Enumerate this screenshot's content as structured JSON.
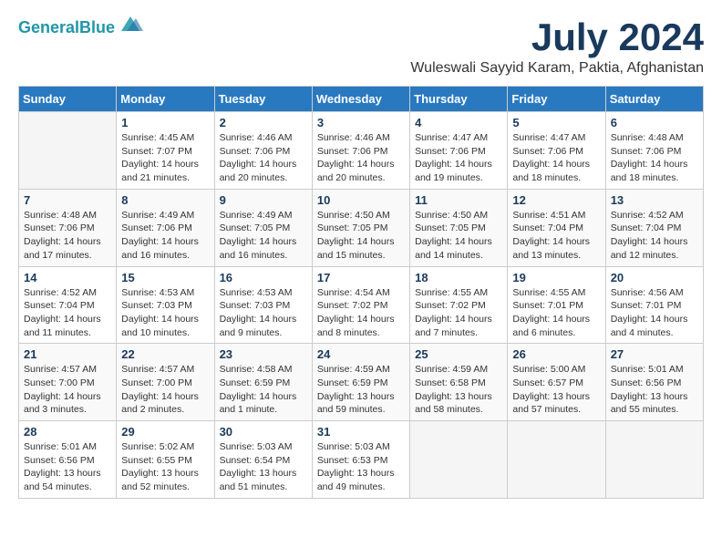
{
  "header": {
    "logo_line1": "General",
    "logo_line2": "Blue",
    "month": "July 2024",
    "location": "Wuleswali Sayyid Karam, Paktia, Afghanistan"
  },
  "weekdays": [
    "Sunday",
    "Monday",
    "Tuesday",
    "Wednesday",
    "Thursday",
    "Friday",
    "Saturday"
  ],
  "weeks": [
    [
      {
        "num": "",
        "info": ""
      },
      {
        "num": "1",
        "info": "Sunrise: 4:45 AM\nSunset: 7:07 PM\nDaylight: 14 hours\nand 21 minutes."
      },
      {
        "num": "2",
        "info": "Sunrise: 4:46 AM\nSunset: 7:06 PM\nDaylight: 14 hours\nand 20 minutes."
      },
      {
        "num": "3",
        "info": "Sunrise: 4:46 AM\nSunset: 7:06 PM\nDaylight: 14 hours\nand 20 minutes."
      },
      {
        "num": "4",
        "info": "Sunrise: 4:47 AM\nSunset: 7:06 PM\nDaylight: 14 hours\nand 19 minutes."
      },
      {
        "num": "5",
        "info": "Sunrise: 4:47 AM\nSunset: 7:06 PM\nDaylight: 14 hours\nand 18 minutes."
      },
      {
        "num": "6",
        "info": "Sunrise: 4:48 AM\nSunset: 7:06 PM\nDaylight: 14 hours\nand 18 minutes."
      }
    ],
    [
      {
        "num": "7",
        "info": "Sunrise: 4:48 AM\nSunset: 7:06 PM\nDaylight: 14 hours\nand 17 minutes."
      },
      {
        "num": "8",
        "info": "Sunrise: 4:49 AM\nSunset: 7:06 PM\nDaylight: 14 hours\nand 16 minutes."
      },
      {
        "num": "9",
        "info": "Sunrise: 4:49 AM\nSunset: 7:05 PM\nDaylight: 14 hours\nand 16 minutes."
      },
      {
        "num": "10",
        "info": "Sunrise: 4:50 AM\nSunset: 7:05 PM\nDaylight: 14 hours\nand 15 minutes."
      },
      {
        "num": "11",
        "info": "Sunrise: 4:50 AM\nSunset: 7:05 PM\nDaylight: 14 hours\nand 14 minutes."
      },
      {
        "num": "12",
        "info": "Sunrise: 4:51 AM\nSunset: 7:04 PM\nDaylight: 14 hours\nand 13 minutes."
      },
      {
        "num": "13",
        "info": "Sunrise: 4:52 AM\nSunset: 7:04 PM\nDaylight: 14 hours\nand 12 minutes."
      }
    ],
    [
      {
        "num": "14",
        "info": "Sunrise: 4:52 AM\nSunset: 7:04 PM\nDaylight: 14 hours\nand 11 minutes."
      },
      {
        "num": "15",
        "info": "Sunrise: 4:53 AM\nSunset: 7:03 PM\nDaylight: 14 hours\nand 10 minutes."
      },
      {
        "num": "16",
        "info": "Sunrise: 4:53 AM\nSunset: 7:03 PM\nDaylight: 14 hours\nand 9 minutes."
      },
      {
        "num": "17",
        "info": "Sunrise: 4:54 AM\nSunset: 7:02 PM\nDaylight: 14 hours\nand 8 minutes."
      },
      {
        "num": "18",
        "info": "Sunrise: 4:55 AM\nSunset: 7:02 PM\nDaylight: 14 hours\nand 7 minutes."
      },
      {
        "num": "19",
        "info": "Sunrise: 4:55 AM\nSunset: 7:01 PM\nDaylight: 14 hours\nand 6 minutes."
      },
      {
        "num": "20",
        "info": "Sunrise: 4:56 AM\nSunset: 7:01 PM\nDaylight: 14 hours\nand 4 minutes."
      }
    ],
    [
      {
        "num": "21",
        "info": "Sunrise: 4:57 AM\nSunset: 7:00 PM\nDaylight: 14 hours\nand 3 minutes."
      },
      {
        "num": "22",
        "info": "Sunrise: 4:57 AM\nSunset: 7:00 PM\nDaylight: 14 hours\nand 2 minutes."
      },
      {
        "num": "23",
        "info": "Sunrise: 4:58 AM\nSunset: 6:59 PM\nDaylight: 14 hours\nand 1 minute."
      },
      {
        "num": "24",
        "info": "Sunrise: 4:59 AM\nSunset: 6:59 PM\nDaylight: 13 hours\nand 59 minutes."
      },
      {
        "num": "25",
        "info": "Sunrise: 4:59 AM\nSunset: 6:58 PM\nDaylight: 13 hours\nand 58 minutes."
      },
      {
        "num": "26",
        "info": "Sunrise: 5:00 AM\nSunset: 6:57 PM\nDaylight: 13 hours\nand 57 minutes."
      },
      {
        "num": "27",
        "info": "Sunrise: 5:01 AM\nSunset: 6:56 PM\nDaylight: 13 hours\nand 55 minutes."
      }
    ],
    [
      {
        "num": "28",
        "info": "Sunrise: 5:01 AM\nSunset: 6:56 PM\nDaylight: 13 hours\nand 54 minutes."
      },
      {
        "num": "29",
        "info": "Sunrise: 5:02 AM\nSunset: 6:55 PM\nDaylight: 13 hours\nand 52 minutes."
      },
      {
        "num": "30",
        "info": "Sunrise: 5:03 AM\nSunset: 6:54 PM\nDaylight: 13 hours\nand 51 minutes."
      },
      {
        "num": "31",
        "info": "Sunrise: 5:03 AM\nSunset: 6:53 PM\nDaylight: 13 hours\nand 49 minutes."
      },
      {
        "num": "",
        "info": ""
      },
      {
        "num": "",
        "info": ""
      },
      {
        "num": "",
        "info": ""
      }
    ]
  ]
}
